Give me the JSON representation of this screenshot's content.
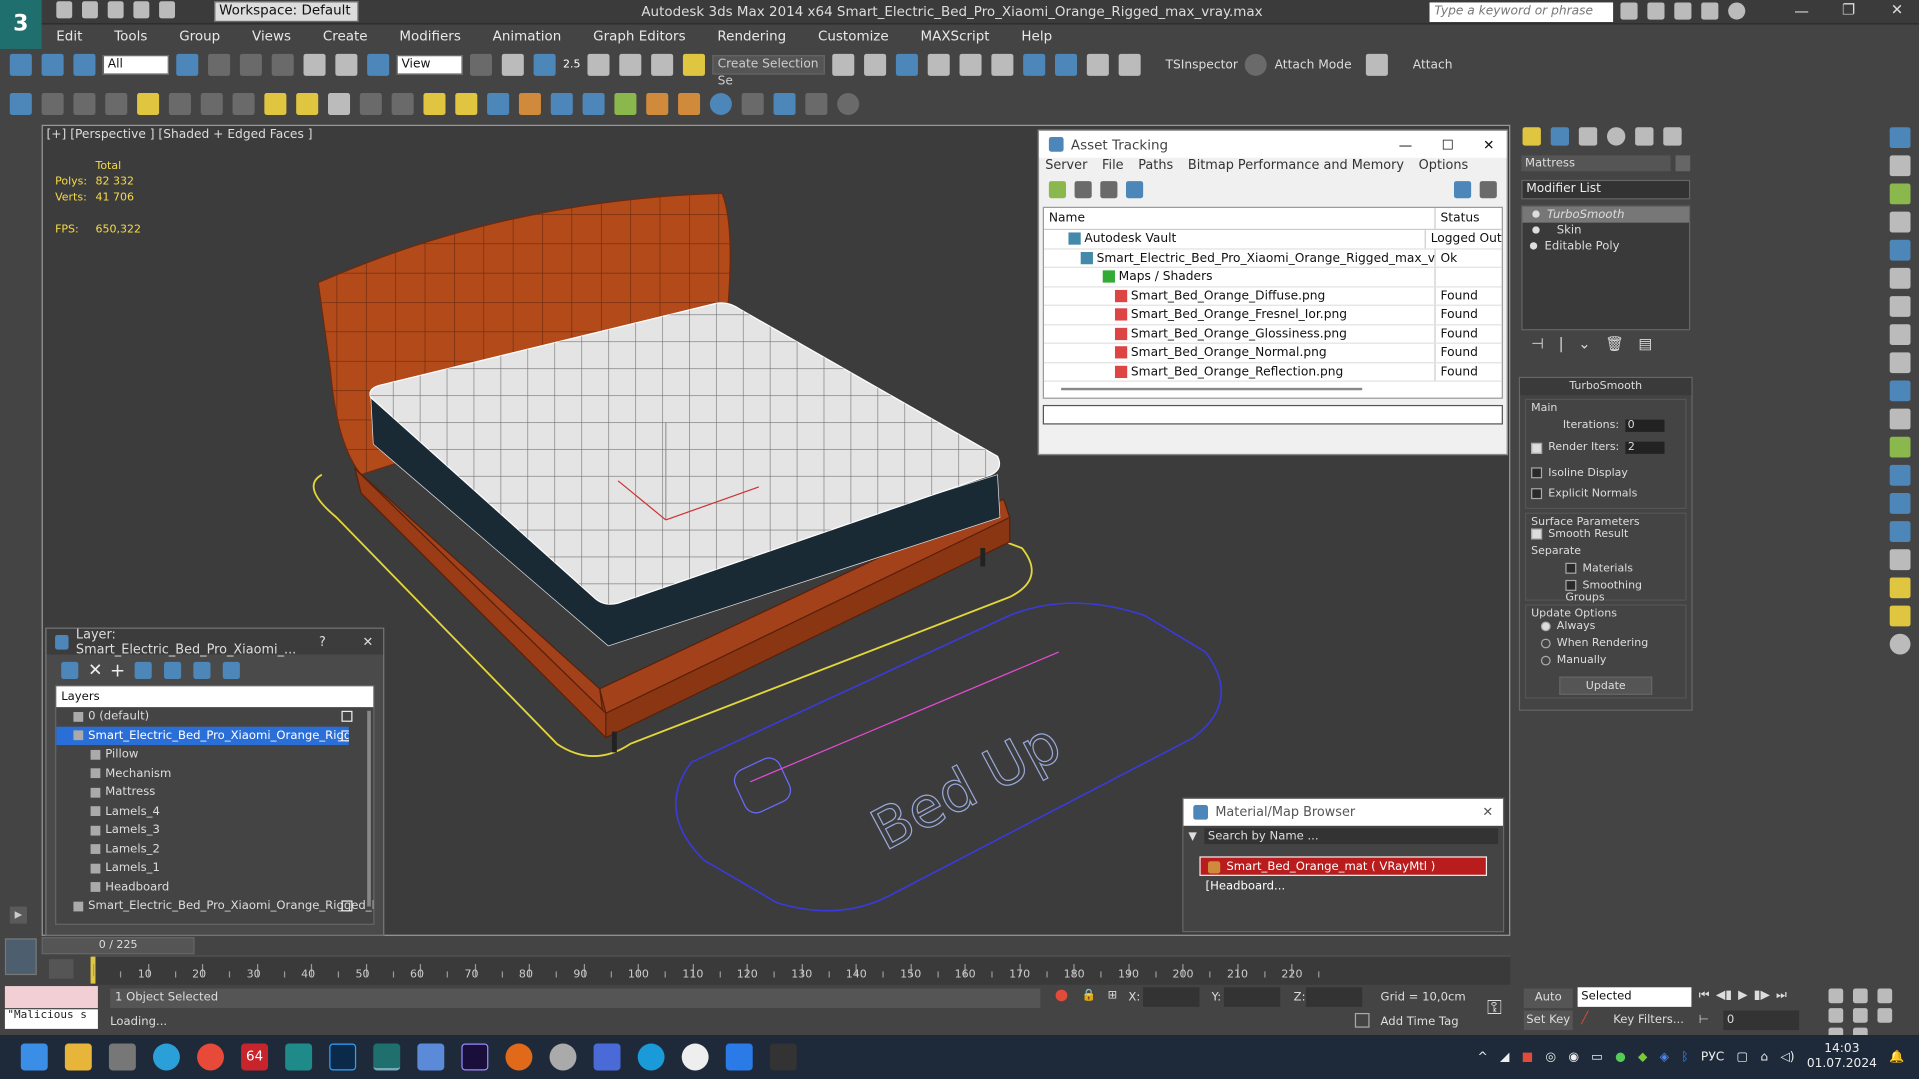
{
  "titlebar": {
    "workspace": "Workspace: Default",
    "title": "Autodesk 3ds Max  2014 x64    Smart_Electric_Bed_Pro_Xiaomi_Orange_Rigged_max_vray.max",
    "search_placeholder": "Type a keyword or phrase"
  },
  "menu": [
    "Edit",
    "Tools",
    "Group",
    "Views",
    "Create",
    "Modifiers",
    "Animation",
    "Graph Editors",
    "Rendering",
    "Customize",
    "MAXScript",
    "Help"
  ],
  "toolbar": {
    "filter": "All",
    "refcoord": "View",
    "selset": "Create Selection Se",
    "tsinspector": "TSInspector",
    "attach_mode": "Attach Mode",
    "attach": "Attach",
    "snap_num": "2.5"
  },
  "viewport": {
    "label": "[+] [Perspective ] [Shaded + Edged Faces ]",
    "stats_total": "Total",
    "polys_label": "Polys:",
    "polys_val": "82 332",
    "verts_label": "Verts:",
    "verts_val": "41 706",
    "fps_label": "FPS:",
    "fps_val": "650,322",
    "plate_text": "Bed Up"
  },
  "asset": {
    "title": "Asset Tracking",
    "menu": [
      "Server",
      "File",
      "Paths",
      "Bitmap Performance and Memory",
      "Options"
    ],
    "col_name": "Name",
    "col_status": "Status",
    "rows": [
      {
        "name": "Autodesk Vault",
        "status": "Logged Out"
      },
      {
        "name": "Smart_Electric_Bed_Pro_Xiaomi_Orange_Rigged_max_vray.max",
        "status": "Ok"
      },
      {
        "name": "Maps / Shaders",
        "status": ""
      },
      {
        "name": "Smart_Bed_Orange_Diffuse.png",
        "status": "Found"
      },
      {
        "name": "Smart_Bed_Orange_Fresnel_Ior.png",
        "status": "Found"
      },
      {
        "name": "Smart_Bed_Orange_Glossiness.png",
        "status": "Found"
      },
      {
        "name": "Smart_Bed_Orange_Normal.png",
        "status": "Found"
      },
      {
        "name": "Smart_Bed_Orange_Reflection.png",
        "status": "Found"
      }
    ]
  },
  "layer": {
    "title": "Layer: Smart_Electric_Bed_Pro_Xiaomi_...",
    "help": "?",
    "header": "Layers",
    "items": [
      "0 (default)",
      "Smart_Electric_Bed_Pro_Xiaomi_Orange_Rigged",
      "Pillow",
      "Mechanism",
      "Mattress",
      "Lamels_4",
      "Lamels_3",
      "Lamels_2",
      "Lamels_1",
      "Headboard",
      "Smart_Electric_Bed_Pro_Xiaomi_Orange_Rigged_bo"
    ]
  },
  "matbrowser": {
    "title": "Material/Map Browser",
    "search": "Search by Name ...",
    "item": "Smart_Bed_Orange_mat  ( VRayMtl ) [Headboard..."
  },
  "cmdpanel": {
    "object": "Mattress",
    "modlist": "Modifier List",
    "stack": [
      "TurboSmooth",
      "Skin",
      "Editable Poly"
    ],
    "roll_title": "TurboSmooth",
    "main": "Main",
    "iterations_label": "Iterations:",
    "iterations": "0",
    "render_iters_label": "Render Iters:",
    "render_iters": "2",
    "isoline": "Isoline Display",
    "explicit": "Explicit Normals",
    "surface": "Surface Parameters",
    "smooth": "Smooth Result",
    "separate": "Separate",
    "materials": "Materials",
    "smoothing": "Smoothing Groups",
    "update_options": "Update Options",
    "always": "Always",
    "when_rendering": "When Rendering",
    "manually": "Manually",
    "update_btn": "Update"
  },
  "timeline": {
    "frame": "0 / 225",
    "ticks": [
      "10",
      "20",
      "30",
      "40",
      "50",
      "60",
      "70",
      "80",
      "90",
      "100",
      "110",
      "120",
      "130",
      "140",
      "150",
      "160",
      "170",
      "180",
      "190",
      "200",
      "210",
      "220"
    ]
  },
  "status": {
    "selected": "1 Object Selected",
    "loading": "Loading...",
    "maxscript": "\"Malicious s",
    "x": "X:",
    "y": "Y:",
    "z": "Z:",
    "grid": "Grid = 10,0cm",
    "add_time_tag": "Add Time Tag",
    "auto_key": "Auto Key",
    "set_key": "Set Key",
    "key_mode": "Selected",
    "key_filters": "Key Filters...",
    "frame_field": "0"
  },
  "taskbar": {
    "badge": "64",
    "lang": "РУС",
    "time": "14:03",
    "date": "01.07.2024"
  }
}
